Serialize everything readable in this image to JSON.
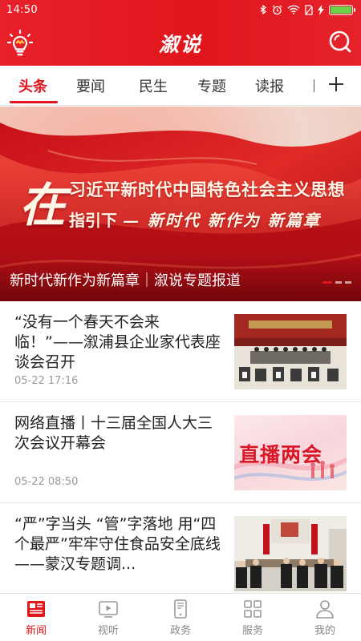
{
  "status_bar": {
    "time": "14:50",
    "icons": [
      "bluetooth-icon",
      "alarm-icon",
      "wifi-icon",
      "no-sim-icon",
      "charging-icon"
    ],
    "battery_level": 1.0
  },
  "app_bar": {
    "title": "溆说",
    "logo_icon": "bulb-logo-icon",
    "search_icon": "search-icon"
  },
  "tabs": {
    "items": [
      {
        "label": "头条",
        "active": true
      },
      {
        "label": "要闻",
        "active": false
      },
      {
        "label": "民生",
        "active": false
      },
      {
        "label": "专题",
        "active": false
      },
      {
        "label": "读报",
        "active": false
      }
    ],
    "add_icon": "plus-icon"
  },
  "banner": {
    "big_char": "在",
    "headline_line1": "习近平新时代中国特色社会主义思想",
    "headline_line2_prefix": "指引下",
    "headline_line2_slogan": "— 新时代 新作为 新篇章",
    "caption": "新时代新作为新篇章｜溆说专题报道",
    "slide_count": 3,
    "active_slide": 0
  },
  "news": [
    {
      "title": "“没有一个春天不会来临！”——溆浦县企业家代表座谈会召开",
      "time": "05-22 17:16",
      "thumb": "meeting-photo"
    },
    {
      "title": "网络直播丨十三届全国人大三次会议开幕会",
      "time": "05-22 08:50",
      "thumb": "live-broadcast-graphic",
      "thumb_text": "直播两会"
    },
    {
      "title": "“严”字当头 “管”字落地 用“四个最严”牢牢守住食品安全底线——蒙汉专题调...",
      "time": "",
      "thumb": "conference-room-photo"
    }
  ],
  "bottom_nav": [
    {
      "label": "新闻",
      "icon": "newspaper-icon",
      "active": true
    },
    {
      "label": "视听",
      "icon": "video-play-icon",
      "active": false
    },
    {
      "label": "政务",
      "icon": "phone-icon",
      "active": false
    },
    {
      "label": "服务",
      "icon": "grid-icon",
      "active": false
    },
    {
      "label": "我的",
      "icon": "user-icon",
      "active": false
    }
  ],
  "colors": {
    "brand_red": "#e0161c",
    "inactive_nav": "#888888",
    "time_gray": "#9a9a9a"
  }
}
